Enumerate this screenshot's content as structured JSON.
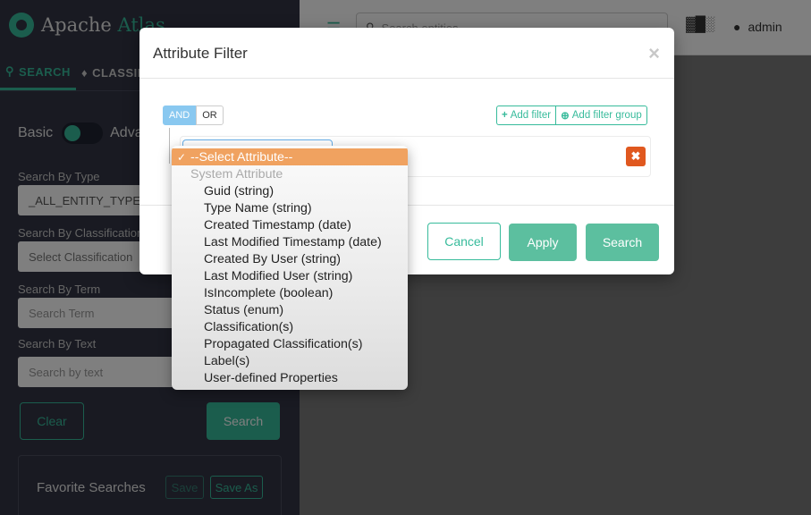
{
  "sidebar": {
    "logo_text_main": "Apache ",
    "logo_text_accent": "Atlas",
    "tabs": [
      {
        "label": "SEARCH",
        "icon": "search-icon"
      },
      {
        "label": "CLASSIFICATION",
        "icon": "tag-icon"
      }
    ],
    "toggle": {
      "left_label": "Basic",
      "right_label": "Advanced"
    },
    "type_label": "Search By Type",
    "type_value": "_ALL_ENTITY_TYPES",
    "classification_label": "Search By Classification",
    "classification_placeholder": "Select Classification",
    "term_label": "Search By Term",
    "term_placeholder": "Search Term",
    "text_label": "Search By Text",
    "text_placeholder": "Search by text",
    "clear_label": "Clear",
    "search_label": "Search",
    "favorites": {
      "title": "Favorite Searches",
      "save_label": "Save",
      "save_as_label": "Save As"
    }
  },
  "topbar": {
    "search_placeholder": "Search entities...",
    "user": "admin"
  },
  "modal": {
    "title": "Attribute Filter",
    "close_glyph": "×",
    "conditions": [
      "AND",
      "OR"
    ],
    "add_filter_label": "Add filter",
    "add_filter_group_label": "Add filter group",
    "delete_glyph": "✖",
    "cancel_label": "Cancel",
    "apply_label": "Apply",
    "search_label": "Search"
  },
  "dropdown": {
    "selected": "--Select Attribute--",
    "group_label": "System Attribute",
    "options": [
      "Guid (string)",
      "Type Name (string)",
      "Created Timestamp (date)",
      "Last Modified Timestamp (date)",
      "Created By User (string)",
      "Last Modified User (string)",
      "IsIncomplete (boolean)",
      "Status (enum)",
      "Classification(s)",
      "Propagated Classification(s)",
      "Label(s)",
      "User-defined Properties"
    ]
  },
  "colors": {
    "accent": "#37bb9b",
    "sidebar": "#323544",
    "selected": "#f0a260",
    "danger": "#e0581f"
  }
}
